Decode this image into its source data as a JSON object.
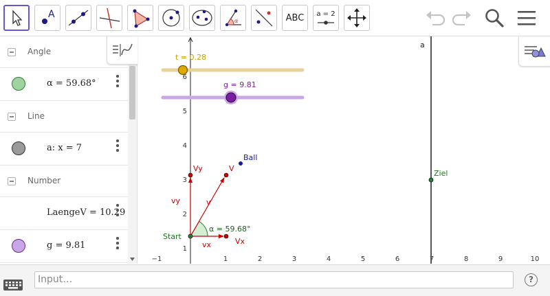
{
  "toolbar": {
    "tools": [
      {
        "name": "move-tool",
        "active": true
      },
      {
        "name": "point-tool",
        "label": "A"
      },
      {
        "name": "line-tool"
      },
      {
        "name": "perpendicular-line-tool"
      },
      {
        "name": "polygon-tool"
      },
      {
        "name": "circle-center-tool"
      },
      {
        "name": "ellipse-tool"
      },
      {
        "name": "angle-tool",
        "label": "α"
      },
      {
        "name": "reflect-tool"
      },
      {
        "name": "text-tool",
        "label": "ABC"
      },
      {
        "name": "slider-tool",
        "label": "a = 2"
      },
      {
        "name": "move-graphics-tool"
      }
    ],
    "accent_color": "#6557d2"
  },
  "algebra": {
    "groups": [
      {
        "label": "Angle",
        "items": [
          {
            "text": "α = 59.68°",
            "color": "#7cc47c"
          }
        ]
      },
      {
        "label": "Line",
        "items": [
          {
            "text": "a: x = 7",
            "color": "#999999"
          }
        ]
      },
      {
        "label": "Number",
        "items": [
          {
            "text": "LaengeV = 10.29",
            "color": null
          },
          {
            "text": "g = 9.81",
            "color": "#c9a6e6"
          }
        ]
      }
    ]
  },
  "graphics": {
    "x_ticks": [
      "−1",
      "1",
      "2",
      "3",
      "4",
      "5",
      "6",
      "7",
      "8",
      "9",
      "10"
    ],
    "y_ticks": [
      "1",
      "2",
      "3",
      "4",
      "5",
      "6"
    ],
    "slider_t": {
      "label": "t = 0.28",
      "value": 0.28,
      "color": "#c8a000"
    },
    "slider_g": {
      "label": "g = 9.81",
      "value": 9.81,
      "color": "#7b1fa2"
    },
    "line_label": "a",
    "points": {
      "start": "Start",
      "ball": "Ball",
      "ziel": "Ziel",
      "vx": "Vx",
      "vy": "Vy",
      "v": "V"
    },
    "vector_labels": {
      "vx": "vx",
      "vy": "vy",
      "v": "v"
    },
    "angle_label": "α = 59.68°"
  },
  "inputbar": {
    "placeholder": "Input…",
    "help": "?"
  }
}
